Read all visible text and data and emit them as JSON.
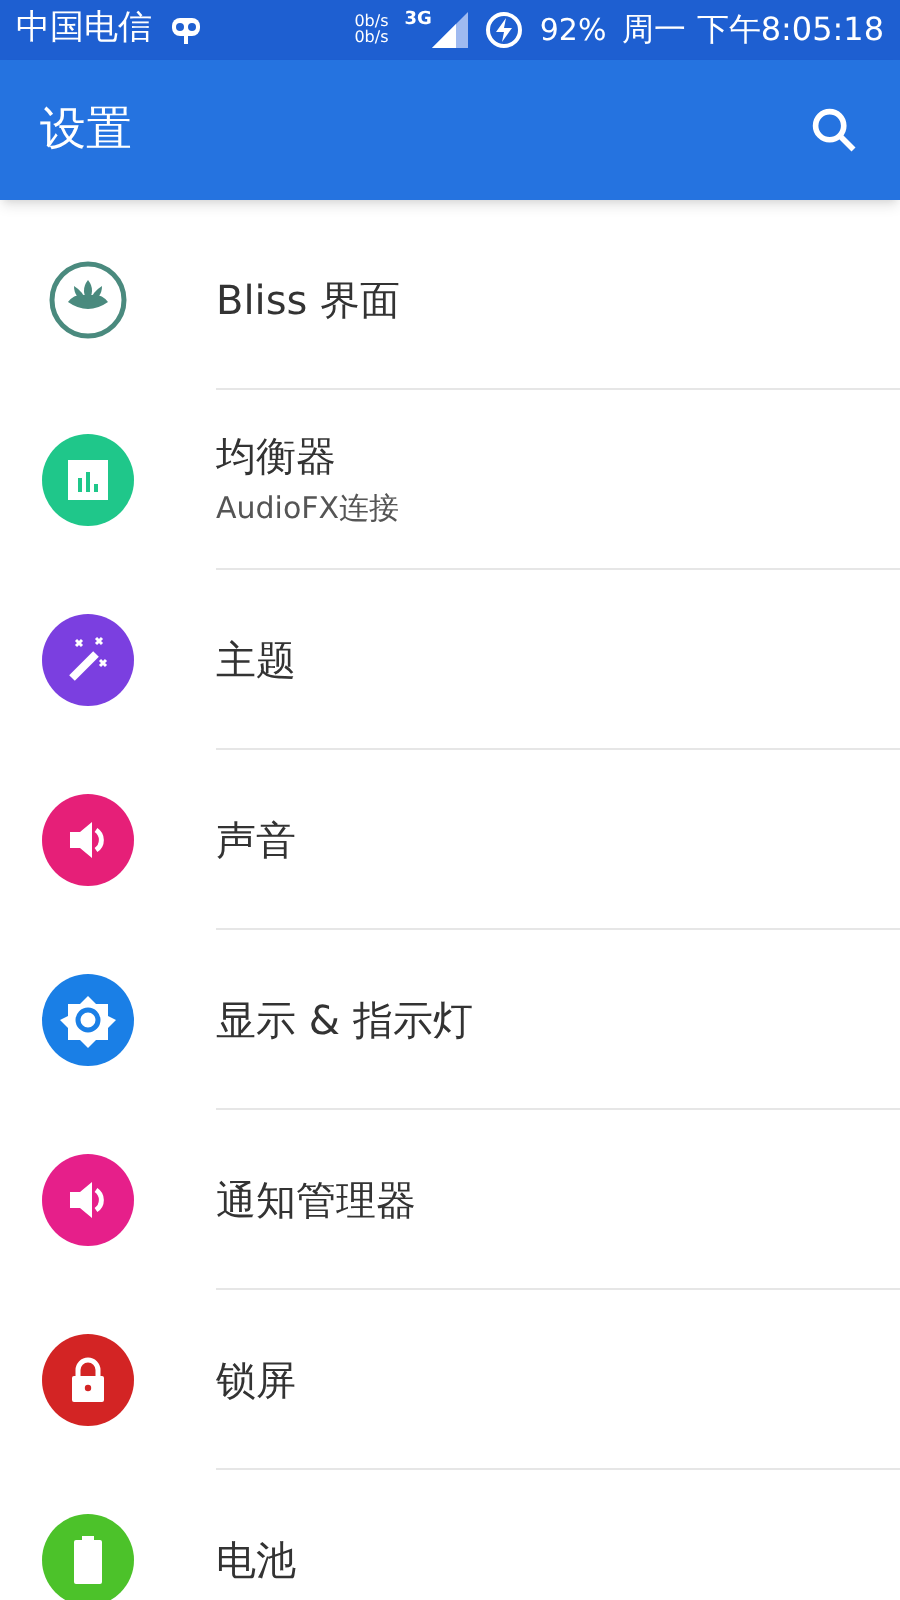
{
  "status_bar": {
    "carrier": "中国电信",
    "net_up": "0b/s",
    "net_down": "0b/s",
    "network": "3G",
    "battery": "92%",
    "time": "周一 下午8:05:18"
  },
  "toolbar": {
    "title": "设置"
  },
  "items": [
    {
      "kind": "lotus",
      "color": "#4a8a7e",
      "title": "Bliss 界面"
    },
    {
      "kind": "equalizer",
      "color": "#1fc78a",
      "title": "均衡器",
      "subtitle": "AudioFX连接"
    },
    {
      "kind": "wand",
      "color": "#7b3fe0",
      "title": "主题"
    },
    {
      "kind": "sound",
      "color": "#e61f78",
      "title": "声音"
    },
    {
      "kind": "display",
      "color": "#1a7fe6",
      "title": "显示 & 指示灯"
    },
    {
      "kind": "sound",
      "color": "#e61f8a",
      "title": "通知管理器"
    },
    {
      "kind": "lock",
      "color": "#d32424",
      "title": "锁屏"
    },
    {
      "kind": "battery",
      "color": "#4cc22a",
      "title": "电池"
    }
  ]
}
